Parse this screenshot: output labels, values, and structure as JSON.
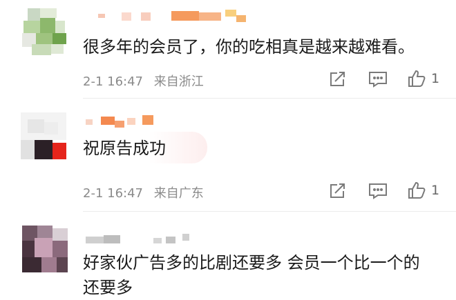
{
  "comments": [
    {
      "text": "很多年的会员了，你的吃相真是越来越难看。",
      "date": "2-1 16:47",
      "location": "来自浙江",
      "likes": "1"
    },
    {
      "text": "祝原告成功",
      "date": "2-1 16:47",
      "location": "来自广东",
      "likes": "1"
    },
    {
      "text": "好家伙广告多的比剧还要多 会员一个比一个的还要多"
    }
  ],
  "icons": {
    "share": "share-icon",
    "reply": "comment-icon",
    "like": "thumbs-up-icon"
  },
  "colors": {
    "text": "#1a1a1a",
    "meta": "#8a8a8a",
    "icon": "#7a7a7a",
    "bubble": "#fdeeee",
    "divider": "#ececec"
  }
}
